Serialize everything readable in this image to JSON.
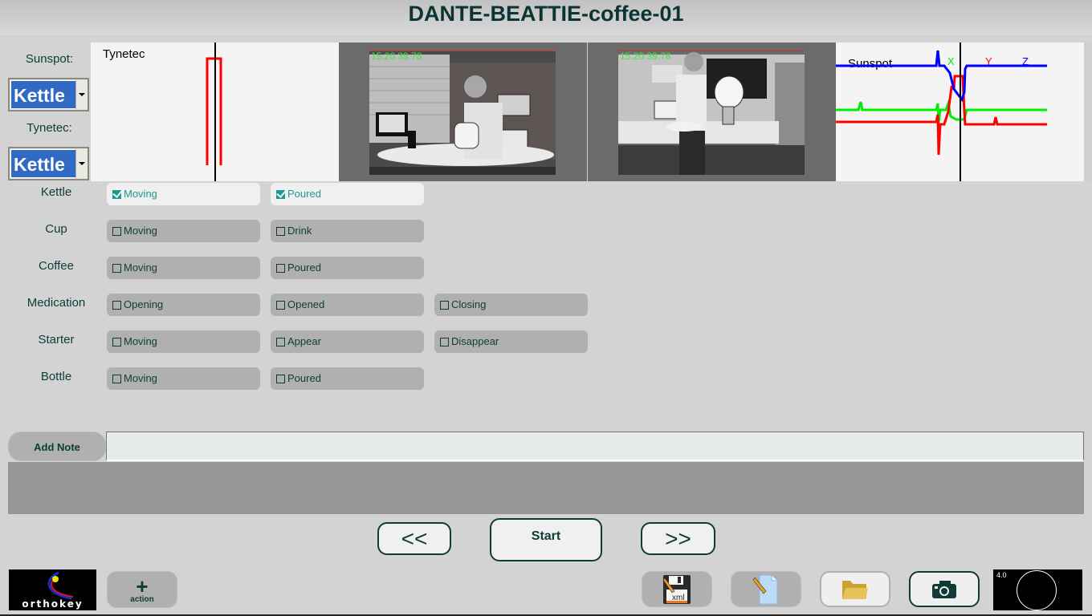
{
  "title": "DANTE-BEATTIE-coffee-01",
  "selectors": [
    {
      "label": "Sunspot:",
      "value": "Kettle"
    },
    {
      "label": "Tynetec:",
      "value": "Kettle"
    }
  ],
  "panels": {
    "tynetec_plot": {
      "label": "Tynetec",
      "trace_color": "#ff0000",
      "cursor_color": "#000000"
    },
    "video_1": {
      "timestamp": "15.20.39.78"
    },
    "video_2": {
      "timestamp": "15.20.39.78"
    },
    "sunspot_plot": {
      "label": "Sunspot",
      "axes": [
        {
          "name": "X",
          "color": "#00ee00"
        },
        {
          "name": "Y",
          "color": "#ff0000"
        },
        {
          "name": "Z",
          "color": "#0000ff"
        }
      ]
    }
  },
  "annotations": [
    {
      "object": "Kettle",
      "actions": [
        {
          "label": "Moving",
          "checked": true
        },
        {
          "label": "Poured",
          "checked": true
        }
      ]
    },
    {
      "object": "Cup",
      "actions": [
        {
          "label": "Moving",
          "checked": false
        },
        {
          "label": "Drink",
          "checked": false
        }
      ]
    },
    {
      "object": "Coffee",
      "actions": [
        {
          "label": "Moving",
          "checked": false
        },
        {
          "label": "Poured",
          "checked": false
        }
      ]
    },
    {
      "object": "Medication",
      "actions": [
        {
          "label": "Opening",
          "checked": false
        },
        {
          "label": "Opened",
          "checked": false
        },
        {
          "label": "Closing",
          "checked": false
        }
      ]
    },
    {
      "object": "Starter",
      "actions": [
        {
          "label": "Moving",
          "checked": false
        },
        {
          "label": "Appear",
          "checked": false
        },
        {
          "label": "Disappear",
          "checked": false
        }
      ]
    },
    {
      "object": "Bottle",
      "actions": [
        {
          "label": "Moving",
          "checked": false
        },
        {
          "label": "Poured",
          "checked": false
        }
      ]
    }
  ],
  "note": {
    "button_label": "Add Note",
    "value": "",
    "log": ""
  },
  "nav": {
    "prev_label": "<<",
    "start_label": "Start",
    "next_label": ">>"
  },
  "footer": {
    "logo_text": "orthokey",
    "action_plus": "+",
    "action_label": "action",
    "tools": [
      {
        "name": "save-xml",
        "icon": "floppy-xml-icon",
        "caption": "xml"
      },
      {
        "name": "edit-file",
        "icon": "edit-document-icon"
      },
      {
        "name": "open-folder",
        "icon": "folder-icon"
      },
      {
        "name": "snapshot",
        "icon": "camera-icon"
      }
    ],
    "meter_value": "4.0"
  }
}
